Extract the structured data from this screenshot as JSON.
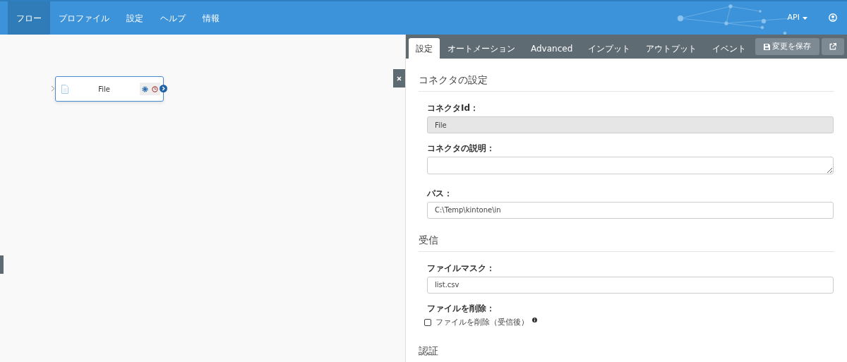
{
  "nav": {
    "items": [
      {
        "label": "フロー",
        "selected": true
      },
      {
        "label": "プロファイル",
        "selected": false
      },
      {
        "label": "設定",
        "selected": false
      },
      {
        "label": "ヘルプ",
        "selected": false
      },
      {
        "label": "情報",
        "selected": false
      }
    ],
    "api_menu": "API"
  },
  "canvas": {
    "node": {
      "label": "File"
    }
  },
  "panel": {
    "tabs": [
      {
        "label": "設定",
        "selected": true
      },
      {
        "label": "オートメーション",
        "selected": false
      },
      {
        "label": "Advanced",
        "selected": false
      },
      {
        "label": "インプット",
        "selected": false
      },
      {
        "label": "アウトプット",
        "selected": false
      },
      {
        "label": "イベント",
        "selected": false
      }
    ],
    "save_button": "変更を保存",
    "sections": [
      {
        "title": "コネクタの設定",
        "fields": [
          {
            "kind": "input",
            "label": "コネクタId：",
            "value": "File",
            "disabled": true
          },
          {
            "kind": "textarea",
            "label": "コネクタの説明：",
            "disabled": false
          },
          {
            "kind": "input",
            "label": "パス：",
            "value": "C:\\Temp\\kintone\\in",
            "disabled": false
          }
        ]
      },
      {
        "title": "受信",
        "fields": [
          {
            "kind": "input",
            "label": "ファイルマスク：",
            "value": "list.csv",
            "disabled": false
          },
          {
            "kind": "checkbox",
            "label": "ファイルを削除：",
            "option": "ファイルを削除（受信後）",
            "checked": false
          }
        ]
      },
      {
        "title": "認証"
      }
    ]
  }
}
